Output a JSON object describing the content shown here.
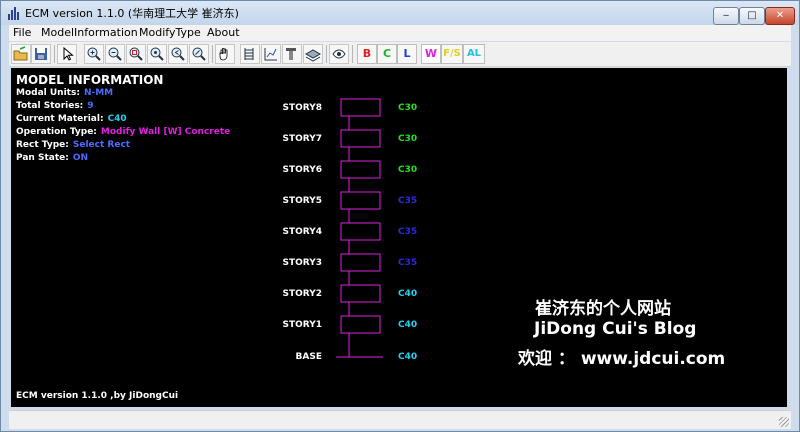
{
  "window": {
    "title": "ECM version 1.1.0  (华南理工大学 崔济东)",
    "controls": {
      "minimize": "‒",
      "maximize": "□",
      "close": "✕"
    }
  },
  "menu": {
    "items": [
      "File",
      "ModelInformation",
      "ModifyType",
      "About"
    ]
  },
  "toolbar": {
    "icons": [
      "open-icon",
      "save-icon",
      "select-arrow-icon",
      "zoom-in-icon",
      "zoom-out-icon",
      "zoom-window-icon",
      "zoom-all-icon",
      "zoom-previous-icon",
      "zoom-extent-icon",
      "pan-hand-icon",
      "story-table-icon",
      "chart-icon",
      "column-icon",
      "layer-icon",
      "view-icon"
    ],
    "filters": [
      {
        "label": "B",
        "color": "#e02020"
      },
      {
        "label": "C",
        "color": "#20b020"
      },
      {
        "label": "L",
        "color": "#2040e0"
      },
      {
        "label": "W",
        "color": "#e020e0"
      },
      {
        "label": "F/S",
        "color": "#e0d020"
      },
      {
        "label": "AL",
        "color": "#20c0e0"
      }
    ]
  },
  "model_info": {
    "title": "MODEL INFORMATION",
    "rows": [
      {
        "label": "Modal Units:",
        "value": "N-MM",
        "color": "#4a6bff"
      },
      {
        "label": "Total Stories:",
        "value": "9",
        "color": "#4a6bff"
      },
      {
        "label": "Current Material:",
        "value": "C40",
        "color": "#1fd0f0"
      },
      {
        "label": "Operation Type:",
        "value": "Modify Wall [W] Concrete",
        "color": "#e020e0"
      },
      {
        "label": "Rect Type:",
        "value": "Select Rect",
        "color": "#4a6bff"
      },
      {
        "label": "Pan State:",
        "value": "ON",
        "color": "#4a6bff"
      }
    ]
  },
  "stories": [
    {
      "name": "STORY8",
      "material": "C30",
      "color": "#20e020"
    },
    {
      "name": "STORY7",
      "material": "C30",
      "color": "#20e020"
    },
    {
      "name": "STORY6",
      "material": "C30",
      "color": "#20e020"
    },
    {
      "name": "STORY5",
      "material": "C35",
      "color": "#2a2ae0"
    },
    {
      "name": "STORY4",
      "material": "C35",
      "color": "#2a2ae0"
    },
    {
      "name": "STORY3",
      "material": "C35",
      "color": "#2a2ae0"
    },
    {
      "name": "STORY2",
      "material": "C40",
      "color": "#1fd0f0"
    },
    {
      "name": "STORY1",
      "material": "C40",
      "color": "#1fd0f0"
    },
    {
      "name": "BASE",
      "material": "C40",
      "color": "#1fd0f0"
    }
  ],
  "watermark": {
    "line1": "崔济东的个人网站",
    "line2": "JiDong Cui's Blog",
    "line3": "欢迎 ： www.jdcui.com"
  },
  "footer": {
    "text": "ECM version 1.1.0 ,by JiDongCui"
  },
  "diagram_color": "#e020e0"
}
